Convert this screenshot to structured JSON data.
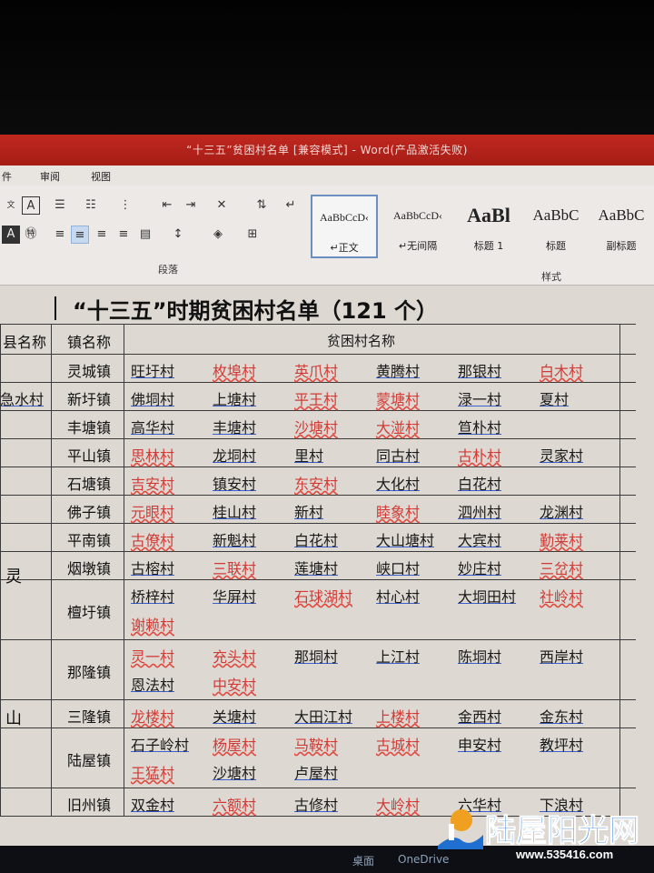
{
  "window": {
    "title": "“十三五”贫困村名单 [兼容模式] - Word(产品激活失败)"
  },
  "menu": {
    "tabs": [
      "件",
      "审阅",
      "视图"
    ]
  },
  "ribbon": {
    "paragraph_label": "段落",
    "styles_label": "样式",
    "styles": [
      {
        "preview": "AaBbCcD‹",
        "name": "↵正文",
        "selected": true
      },
      {
        "preview": "AaBbCcD‹",
        "name": "↵无间隔",
        "selected": false
      },
      {
        "preview": "AaBl",
        "name": "标题 1",
        "selected": false
      },
      {
        "preview": "AaBbC",
        "name": "标题",
        "selected": false
      },
      {
        "preview": "AaBbC",
        "name": "副标题",
        "selected": false
      }
    ]
  },
  "document": {
    "title": "“十三五”时期贫困村名单（121 个）",
    "headers": {
      "county": "县名称",
      "town": "镇名称",
      "villages": "贫困村名称"
    },
    "county_chars": [
      "灵",
      "山"
    ],
    "rows": [
      {
        "town": "灵城镇",
        "lines": [
          [
            [
              "旺圩村",
              "b"
            ],
            [
              "枚埠村",
              "r"
            ],
            [
              "英爪村",
              "r"
            ],
            [
              "黄腾村",
              "b"
            ],
            [
              "那银村",
              "b"
            ],
            [
              "白木村",
              "r"
            ]
          ]
        ]
      },
      {
        "town": "新圩镇",
        "lines": [
          [
            [
              "佛垌村",
              "b"
            ],
            [
              "上塘村",
              "b"
            ],
            [
              "平王村",
              "r"
            ],
            [
              "蒙塘村",
              "r"
            ],
            [
              "渌一村",
              "b"
            ],
            [
              "夏村",
              "b"
            ],
            [
              "急水村",
              "b"
            ]
          ]
        ]
      },
      {
        "town": "丰塘镇",
        "lines": [
          [
            [
              "高华村",
              "b"
            ],
            [
              "丰塘村",
              "b"
            ],
            [
              "沙塘村",
              "r"
            ],
            [
              "大湴村",
              "r"
            ],
            [
              "笪朴村",
              "b"
            ]
          ]
        ]
      },
      {
        "town": "平山镇",
        "lines": [
          [
            [
              "思林村",
              "r"
            ],
            [
              "龙垌村",
              "b"
            ],
            [
              "里村",
              "b"
            ],
            [
              "同古村",
              "b"
            ],
            [
              "古朴村",
              "r"
            ],
            [
              "灵家村",
              "b"
            ]
          ]
        ]
      },
      {
        "town": "石塘镇",
        "lines": [
          [
            [
              "吉安村",
              "r"
            ],
            [
              "镇安村",
              "b"
            ],
            [
              "东安村",
              "r"
            ],
            [
              "大化村",
              "b"
            ],
            [
              "白花村",
              "b"
            ]
          ]
        ]
      },
      {
        "town": "佛子镇",
        "lines": [
          [
            [
              "元眼村",
              "r"
            ],
            [
              "桂山村",
              "b"
            ],
            [
              "新村",
              "b"
            ],
            [
              "睦象村",
              "r"
            ],
            [
              "泗州村",
              "b"
            ],
            [
              "龙渊村",
              "b"
            ]
          ]
        ]
      },
      {
        "town": "平南镇",
        "lines": [
          [
            [
              "古僚村",
              "r"
            ],
            [
              "新魁村",
              "b"
            ],
            [
              "白花村",
              "b"
            ],
            [
              "大山塘村",
              "b"
            ],
            [
              "大宾村",
              "b"
            ],
            [
              "勤莱村",
              "r"
            ]
          ]
        ]
      },
      {
        "town": "烟墩镇",
        "lines": [
          [
            [
              "古榕村",
              "b"
            ],
            [
              "三联村",
              "r"
            ],
            [
              "莲塘村",
              "b"
            ],
            [
              "峡口村",
              "b"
            ],
            [
              "妙庄村",
              "b"
            ],
            [
              "三岔村",
              "r"
            ]
          ]
        ]
      },
      {
        "town": "檀圩镇",
        "lines": [
          [
            [
              "桥梓村",
              "b"
            ],
            [
              "华屏村",
              "b"
            ],
            [
              "石球湖村",
              "r"
            ],
            [
              "村心村",
              "b"
            ],
            [
              "大垌田村",
              "b"
            ],
            [
              "社岭村",
              "r"
            ]
          ],
          [
            [
              "谢赖村",
              "r"
            ]
          ]
        ]
      },
      {
        "town": "那隆镇",
        "lines": [
          [
            [
              "灵一村",
              "r"
            ],
            [
              "充头村",
              "r"
            ],
            [
              "那垌村",
              "b"
            ],
            [
              "上江村",
              "b"
            ],
            [
              "陈垌村",
              "b"
            ],
            [
              "西岸村",
              "b"
            ]
          ],
          [
            [
              "恩法村",
              "b"
            ],
            [
              "中安村",
              "r"
            ]
          ]
        ]
      },
      {
        "town": "三隆镇",
        "lines": [
          [
            [
              "龙楼村",
              "r"
            ],
            [
              "关塘村",
              "b"
            ],
            [
              "大田江村",
              "b"
            ],
            [
              "上楼村",
              "r"
            ],
            [
              "金西村",
              "b"
            ],
            [
              "金东村",
              "b"
            ]
          ]
        ]
      },
      {
        "town": "陆屋镇",
        "lines": [
          [
            [
              "石子岭村",
              "b"
            ],
            [
              "杨屋村",
              "r"
            ],
            [
              "马鞍村",
              "r"
            ],
            [
              "古城村",
              "r"
            ],
            [
              "申安村",
              "b"
            ],
            [
              "教坪村",
              "b"
            ]
          ],
          [
            [
              "王猛村",
              "r"
            ],
            [
              "沙塘村",
              "b"
            ],
            [
              "卢屋村",
              "b"
            ]
          ]
        ]
      },
      {
        "town": "旧州镇",
        "lines": [
          [
            [
              "双金村",
              "b"
            ],
            [
              "六额村",
              "r"
            ],
            [
              "古修村",
              "b"
            ],
            [
              "大岭村",
              "r"
            ],
            [
              "六华村",
              "b"
            ],
            [
              "下浪村",
              "b"
            ]
          ]
        ]
      }
    ]
  },
  "taskbar": {
    "items": [
      "桌面",
      "OneDrive"
    ]
  },
  "watermark": {
    "text": "陆屋阳光网",
    "url": "www.535416.com"
  }
}
